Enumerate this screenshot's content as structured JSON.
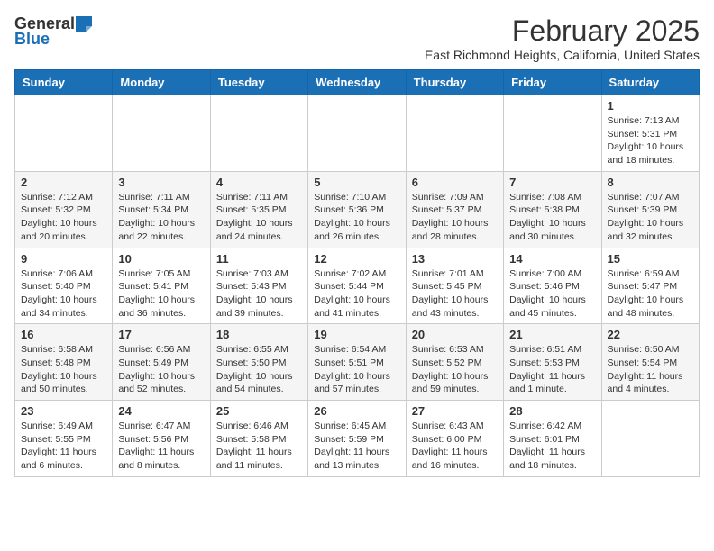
{
  "header": {
    "logo_general": "General",
    "logo_blue": "Blue",
    "month_title": "February 2025",
    "location": "East Richmond Heights, California, United States"
  },
  "days_of_week": [
    "Sunday",
    "Monday",
    "Tuesday",
    "Wednesday",
    "Thursday",
    "Friday",
    "Saturday"
  ],
  "weeks": [
    [
      {
        "day": "",
        "content": ""
      },
      {
        "day": "",
        "content": ""
      },
      {
        "day": "",
        "content": ""
      },
      {
        "day": "",
        "content": ""
      },
      {
        "day": "",
        "content": ""
      },
      {
        "day": "",
        "content": ""
      },
      {
        "day": "1",
        "content": "Sunrise: 7:13 AM\nSunset: 5:31 PM\nDaylight: 10 hours and 18 minutes."
      }
    ],
    [
      {
        "day": "2",
        "content": "Sunrise: 7:12 AM\nSunset: 5:32 PM\nDaylight: 10 hours and 20 minutes."
      },
      {
        "day": "3",
        "content": "Sunrise: 7:11 AM\nSunset: 5:34 PM\nDaylight: 10 hours and 22 minutes."
      },
      {
        "day": "4",
        "content": "Sunrise: 7:11 AM\nSunset: 5:35 PM\nDaylight: 10 hours and 24 minutes."
      },
      {
        "day": "5",
        "content": "Sunrise: 7:10 AM\nSunset: 5:36 PM\nDaylight: 10 hours and 26 minutes."
      },
      {
        "day": "6",
        "content": "Sunrise: 7:09 AM\nSunset: 5:37 PM\nDaylight: 10 hours and 28 minutes."
      },
      {
        "day": "7",
        "content": "Sunrise: 7:08 AM\nSunset: 5:38 PM\nDaylight: 10 hours and 30 minutes."
      },
      {
        "day": "8",
        "content": "Sunrise: 7:07 AM\nSunset: 5:39 PM\nDaylight: 10 hours and 32 minutes."
      }
    ],
    [
      {
        "day": "9",
        "content": "Sunrise: 7:06 AM\nSunset: 5:40 PM\nDaylight: 10 hours and 34 minutes."
      },
      {
        "day": "10",
        "content": "Sunrise: 7:05 AM\nSunset: 5:41 PM\nDaylight: 10 hours and 36 minutes."
      },
      {
        "day": "11",
        "content": "Sunrise: 7:03 AM\nSunset: 5:43 PM\nDaylight: 10 hours and 39 minutes."
      },
      {
        "day": "12",
        "content": "Sunrise: 7:02 AM\nSunset: 5:44 PM\nDaylight: 10 hours and 41 minutes."
      },
      {
        "day": "13",
        "content": "Sunrise: 7:01 AM\nSunset: 5:45 PM\nDaylight: 10 hours and 43 minutes."
      },
      {
        "day": "14",
        "content": "Sunrise: 7:00 AM\nSunset: 5:46 PM\nDaylight: 10 hours and 45 minutes."
      },
      {
        "day": "15",
        "content": "Sunrise: 6:59 AM\nSunset: 5:47 PM\nDaylight: 10 hours and 48 minutes."
      }
    ],
    [
      {
        "day": "16",
        "content": "Sunrise: 6:58 AM\nSunset: 5:48 PM\nDaylight: 10 hours and 50 minutes."
      },
      {
        "day": "17",
        "content": "Sunrise: 6:56 AM\nSunset: 5:49 PM\nDaylight: 10 hours and 52 minutes."
      },
      {
        "day": "18",
        "content": "Sunrise: 6:55 AM\nSunset: 5:50 PM\nDaylight: 10 hours and 54 minutes."
      },
      {
        "day": "19",
        "content": "Sunrise: 6:54 AM\nSunset: 5:51 PM\nDaylight: 10 hours and 57 minutes."
      },
      {
        "day": "20",
        "content": "Sunrise: 6:53 AM\nSunset: 5:52 PM\nDaylight: 10 hours and 59 minutes."
      },
      {
        "day": "21",
        "content": "Sunrise: 6:51 AM\nSunset: 5:53 PM\nDaylight: 11 hours and 1 minute."
      },
      {
        "day": "22",
        "content": "Sunrise: 6:50 AM\nSunset: 5:54 PM\nDaylight: 11 hours and 4 minutes."
      }
    ],
    [
      {
        "day": "23",
        "content": "Sunrise: 6:49 AM\nSunset: 5:55 PM\nDaylight: 11 hours and 6 minutes."
      },
      {
        "day": "24",
        "content": "Sunrise: 6:47 AM\nSunset: 5:56 PM\nDaylight: 11 hours and 8 minutes."
      },
      {
        "day": "25",
        "content": "Sunrise: 6:46 AM\nSunset: 5:58 PM\nDaylight: 11 hours and 11 minutes."
      },
      {
        "day": "26",
        "content": "Sunrise: 6:45 AM\nSunset: 5:59 PM\nDaylight: 11 hours and 13 minutes."
      },
      {
        "day": "27",
        "content": "Sunrise: 6:43 AM\nSunset: 6:00 PM\nDaylight: 11 hours and 16 minutes."
      },
      {
        "day": "28",
        "content": "Sunrise: 6:42 AM\nSunset: 6:01 PM\nDaylight: 11 hours and 18 minutes."
      },
      {
        "day": "",
        "content": ""
      }
    ]
  ]
}
